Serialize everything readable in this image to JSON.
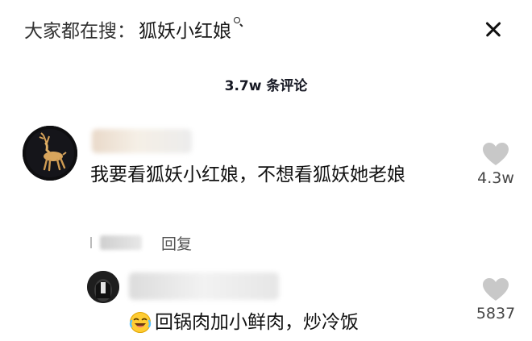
{
  "search_hint": {
    "prefix": "大家都在搜：",
    "keyword": "狐妖小红娘"
  },
  "header": {
    "comment_count": "3.7w 条评论"
  },
  "comments": [
    {
      "text": "我要看狐妖小红娘，不想看狐妖她老娘",
      "likes": "4.3w",
      "reply_label": "回复"
    }
  ],
  "replies": [
    {
      "text": "回锅肉加小鲜肉，炒冷饭",
      "likes": "5837",
      "emoji": "laughing-crying-emoji"
    }
  ],
  "icons": {
    "search": "search-icon",
    "close": "close-icon",
    "like": "heart-icon"
  },
  "colors": {
    "heart": "#c8c8c8",
    "text": "#161823",
    "muted": "#555555"
  }
}
